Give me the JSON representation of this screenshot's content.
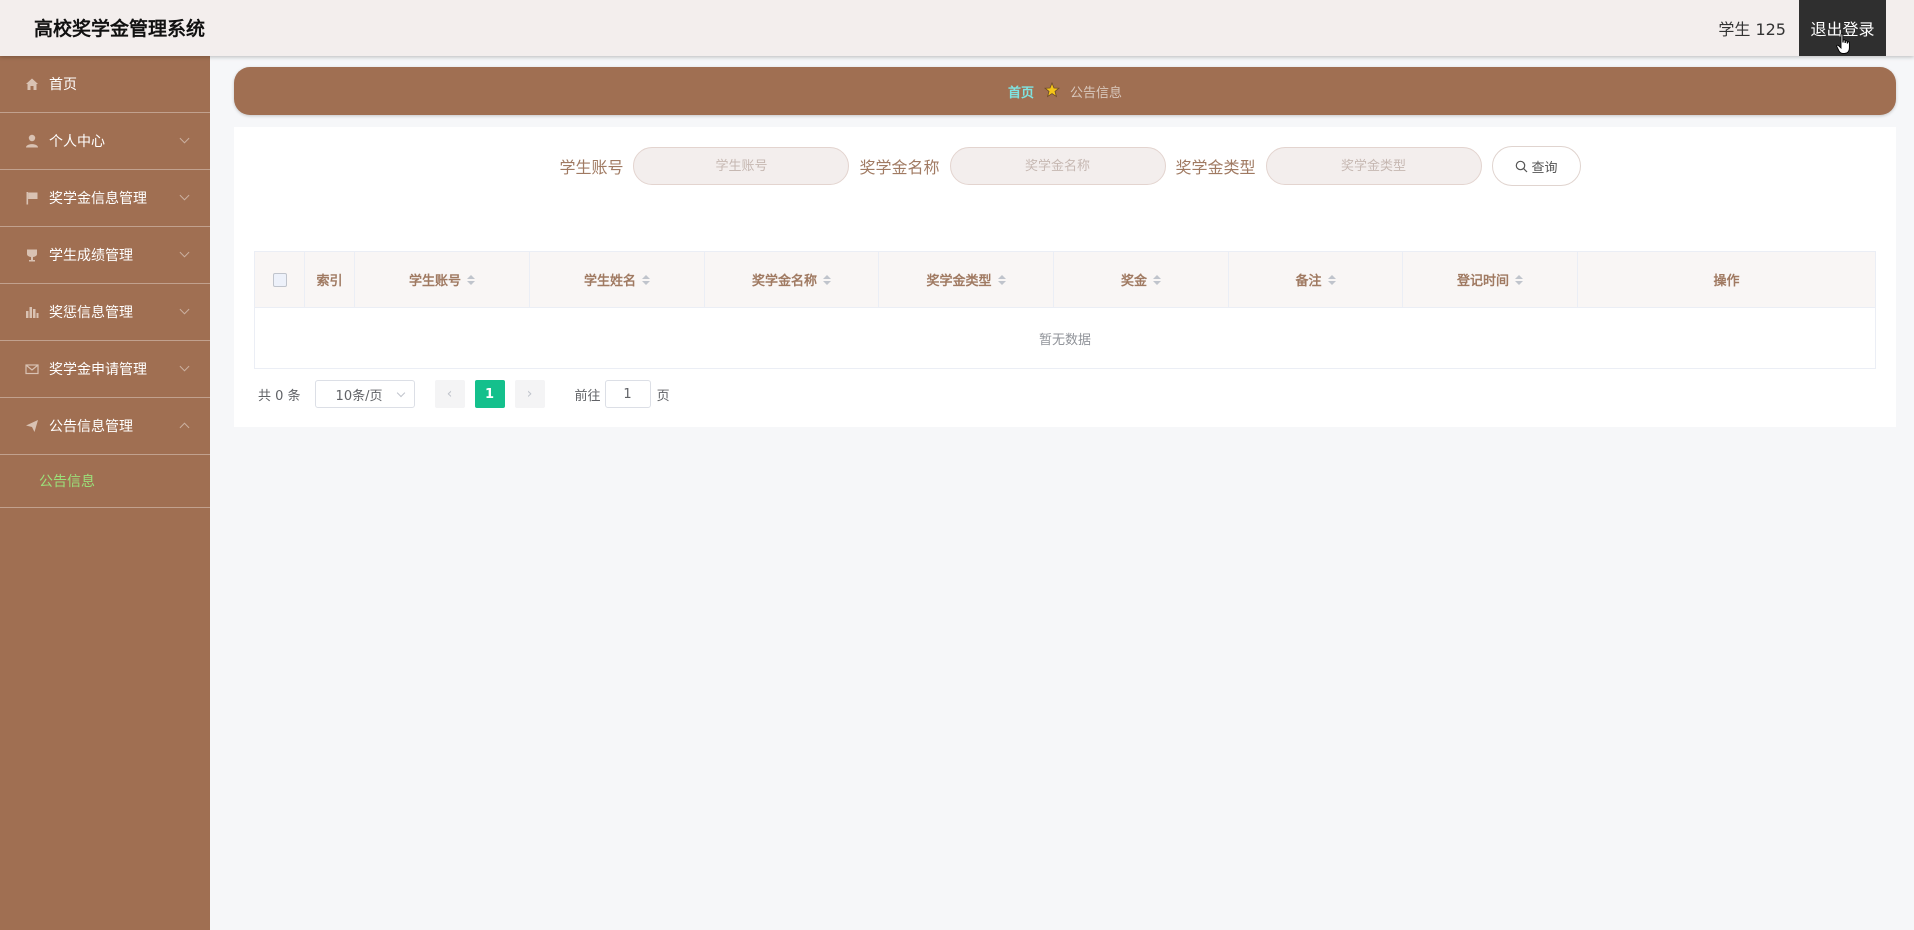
{
  "app": {
    "title": "高校奖学金管理系统"
  },
  "header": {
    "user": "学生 125",
    "logout_label": "退出登录"
  },
  "sidebar": {
    "items": [
      {
        "label": "首页",
        "icon": "home-icon"
      },
      {
        "label": "个人中心",
        "icon": "user-icon"
      },
      {
        "label": "奖学金信息管理",
        "icon": "flag-icon"
      },
      {
        "label": "学生成绩管理",
        "icon": "trophy-icon"
      },
      {
        "label": "奖惩信息管理",
        "icon": "bar-chart-icon"
      },
      {
        "label": "奖学金申请管理",
        "icon": "mail-icon"
      },
      {
        "label": "公告信息管理",
        "icon": "send-icon"
      }
    ],
    "subitem": {
      "label": "公告信息"
    }
  },
  "breadcrumb": {
    "home": "首页",
    "current": "公告信息"
  },
  "search": {
    "fields": [
      {
        "label": "学生账号",
        "placeholder": "学生账号"
      },
      {
        "label": "奖学金名称",
        "placeholder": "奖学金名称"
      },
      {
        "label": "奖学金类型",
        "placeholder": "奖学金类型"
      }
    ],
    "query_label": "查询"
  },
  "table": {
    "columns": [
      "索引",
      "学生账号",
      "学生姓名",
      "奖学金名称",
      "奖学金类型",
      "奖金",
      "备注",
      "登记时间",
      "操作"
    ],
    "empty_text": "暂无数据"
  },
  "pagination": {
    "total": "共 0 条",
    "page_size": "10条/页",
    "current_page": "1",
    "goto_prefix": "前往",
    "goto_value": "1",
    "goto_suffix": "页"
  },
  "colors": {
    "sidebar_bg": "#a06f52",
    "topbar_bg": "#f3eeed",
    "active_page": "#14c08c",
    "submenu_active": "#9be07a",
    "breadcrumb_home": "#7fe3e0"
  }
}
